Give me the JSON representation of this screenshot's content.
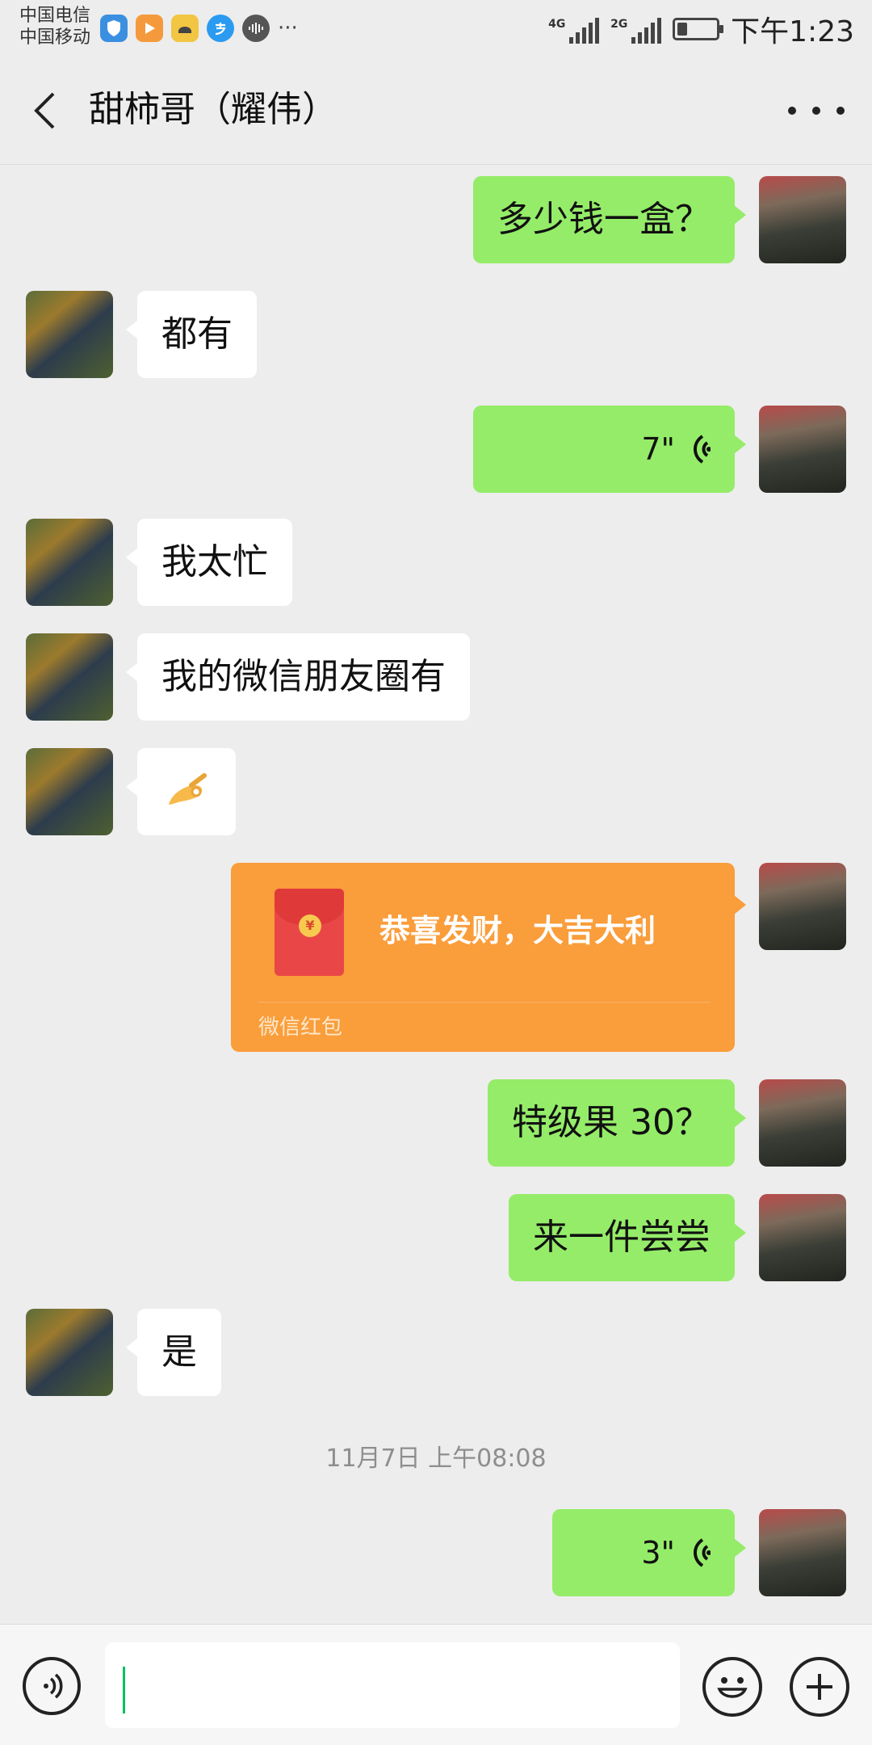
{
  "status_bar": {
    "carrier_1": "中国电信",
    "carrier_2": "中国移动",
    "network_1": "4G",
    "network_2": "2G",
    "time": "下午1:23",
    "more_indicator": "···",
    "app_icons": [
      "shield-icon",
      "video-play-icon",
      "face-icon",
      "alipay-icon",
      "audio-icon"
    ],
    "battery_level_percent": 25
  },
  "header": {
    "title": "甜柿哥（耀伟）"
  },
  "messages": [
    {
      "sender": "me",
      "type": "text",
      "text": "多少钱一盒？"
    },
    {
      "sender": "them",
      "type": "text",
      "text": "都有"
    },
    {
      "sender": "me",
      "type": "voice",
      "duration": "7\""
    },
    {
      "sender": "them",
      "type": "text",
      "text": "我太忙"
    },
    {
      "sender": "them",
      "type": "text",
      "text": "我的微信朋友圈有"
    },
    {
      "sender": "them",
      "type": "emoji",
      "text": "👌"
    },
    {
      "sender": "me",
      "type": "red_packet",
      "title": "恭喜发财，大吉大利",
      "label": "微信红包"
    },
    {
      "sender": "me",
      "type": "text",
      "text": "特级果 30？"
    },
    {
      "sender": "me",
      "type": "text",
      "text": "来一件尝尝"
    },
    {
      "sender": "them",
      "type": "text",
      "text": "是"
    },
    {
      "type": "timestamp",
      "text": "11月7日 上午08:08"
    },
    {
      "sender": "me",
      "type": "voice",
      "duration": "3\""
    }
  ],
  "colors": {
    "background": "#ededed",
    "my_bubble": "#95ec69",
    "their_bubble": "#ffffff",
    "red_packet": "#fa9d3b",
    "cursor": "#07c160"
  }
}
